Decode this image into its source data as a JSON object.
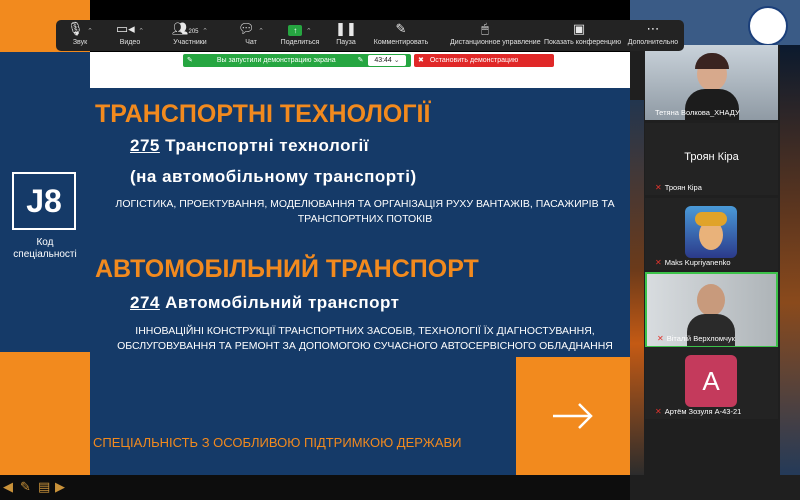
{
  "toolbar": {
    "items": [
      {
        "label": "Звук",
        "icon": "microphone-icon"
      },
      {
        "label": "Видео",
        "icon": "video-camera-icon"
      },
      {
        "label": "Участники",
        "icon": "participants-icon",
        "count": "205"
      },
      {
        "label": "Чат",
        "icon": "chat-icon"
      },
      {
        "label": "Поделиться",
        "icon": "share-screen-icon"
      },
      {
        "label": "Пауза",
        "icon": "pause-icon"
      },
      {
        "label": "Комментировать",
        "icon": "pencil-icon"
      },
      {
        "label": "Дистанционное управление",
        "icon": "mouse-icon"
      },
      {
        "label": "Показать конференцию",
        "icon": "show-meeting-icon"
      },
      {
        "label": "Дополнительно",
        "icon": "more-icon"
      }
    ]
  },
  "share_notice": {
    "text": "Вы запустили демонстрацию экрана",
    "timer": "43:44",
    "stop_label": "Остановить демонстрацию"
  },
  "left_strip": {
    "code": "J8",
    "code_label": "Код спеціальності"
  },
  "slide": {
    "heading1": "ТРАНСПОРТНІ ТЕХНОЛОГІЇ",
    "spec1_number": "275",
    "spec1_title": "Транспортні технології",
    "spec1_subtitle": "(на автомобільному транспорті)",
    "spec1_desc": "ЛОГІСТИКА, ПРОЕКТУВАННЯ, МОДЕЛЮВАННЯ ТА ОРГАНІЗАЦІЯ РУХУ ВАНТАЖІВ, ПАСАЖИРІВ ТА ТРАНСПОРТНИХ ПОТОКІВ",
    "heading2": "АВТОМОБІЛЬНИЙ ТРАНСПОРТ",
    "spec2_number": "274",
    "spec2_title": "Автомобільний транспорт",
    "spec2_desc": "ІННОВАЦІЙНІ КОНСТРУКЦІЇ ТРАНСПОРТНИХ ЗАСОБІВ, ТЕХНОЛОГІЇ ЇХ ДІАГНОСТУВАННЯ, ОБСЛУГОВУВАННЯ ТА РЕМОНТ ЗА ДОПОМОГОЮ СУЧАСНОГО АВТОСЕРВІСНОГО ОБЛАДНАННЯ",
    "support_text": "СПЕЦІАЛЬНІСТЬ З ОСОБЛИВОЮ ПІДТРИМКОЮ ДЕРЖАВИ",
    "arrow_glyph": "→"
  },
  "participants": [
    {
      "name": "Тетяна Волкова_ХНАДУ",
      "type": "video"
    },
    {
      "name": "Троян Кіра",
      "type": "name",
      "display": "Троян Кіра"
    },
    {
      "name": "Maks Kupriyanenko",
      "type": "avatar"
    },
    {
      "name": "Віталій Верхломчук",
      "type": "video"
    },
    {
      "name": "Артём Зозуля А-43-21",
      "type": "letter",
      "letter": "А"
    }
  ],
  "colors": {
    "slide_blue": "#153a68",
    "accent_orange": "#f28a1e",
    "share_green": "#26a641",
    "stop_red": "#e02828",
    "avatar_pink": "#c43a5c"
  }
}
